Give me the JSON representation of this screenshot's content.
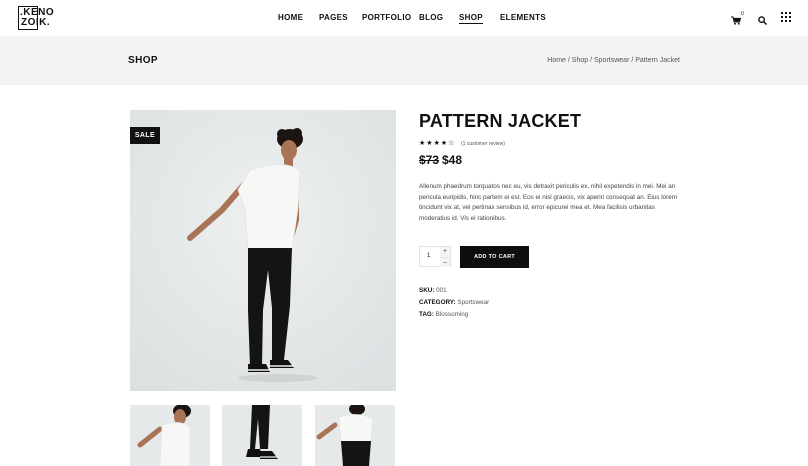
{
  "header": {
    "logo": {
      "line1": ".KENO",
      "line2": "ZOIK."
    },
    "nav": [
      {
        "label": "HOME"
      },
      {
        "label": "PAGES"
      },
      {
        "label": "PORTFOLIO"
      },
      {
        "label": "BLOG"
      },
      {
        "label": "SHOP",
        "active": true
      },
      {
        "label": "ELEMENTS"
      }
    ],
    "cart_count": "0"
  },
  "title_band": {
    "title": "SHOP",
    "breadcrumb": [
      "Home",
      "Shop",
      "Sportswear",
      "Pattern Jacket"
    ],
    "separator": " / "
  },
  "product": {
    "badge": "SALE",
    "title": "PATTERN JACKET",
    "rating": 4,
    "rating_max": 5,
    "review_text": "(1 customer review)",
    "old_price": "$73",
    "new_price": "$48",
    "description": "Allenum phaedrum torquatos nec eu, vis detraxit periculis ex, nihil expetendis in mei. Mei an pericula euripidis, hinc partem ei est. Eos ei nisl graecis, vix aperiri consequat an. Eius lorem tincidunt vix at, vel pertinax sensibus id, error epicurei mea et. Mea facilisis urbanitas moderatius id. Vis ei rationibus.",
    "quantity": "1",
    "qty_up": "+",
    "qty_down": "–",
    "add_to_cart": "ADD TO CART",
    "sku_label": "SKU:",
    "sku": "001",
    "category_label": "CATEGORY:",
    "category": "Sportswear",
    "tag_label": "TAG:",
    "tag": "Blossoming"
  },
  "colors": {
    "text": "#111111",
    "band": "#f3f3f3",
    "photo_bg": "#e9ecec",
    "button": "#0d0d0d"
  }
}
